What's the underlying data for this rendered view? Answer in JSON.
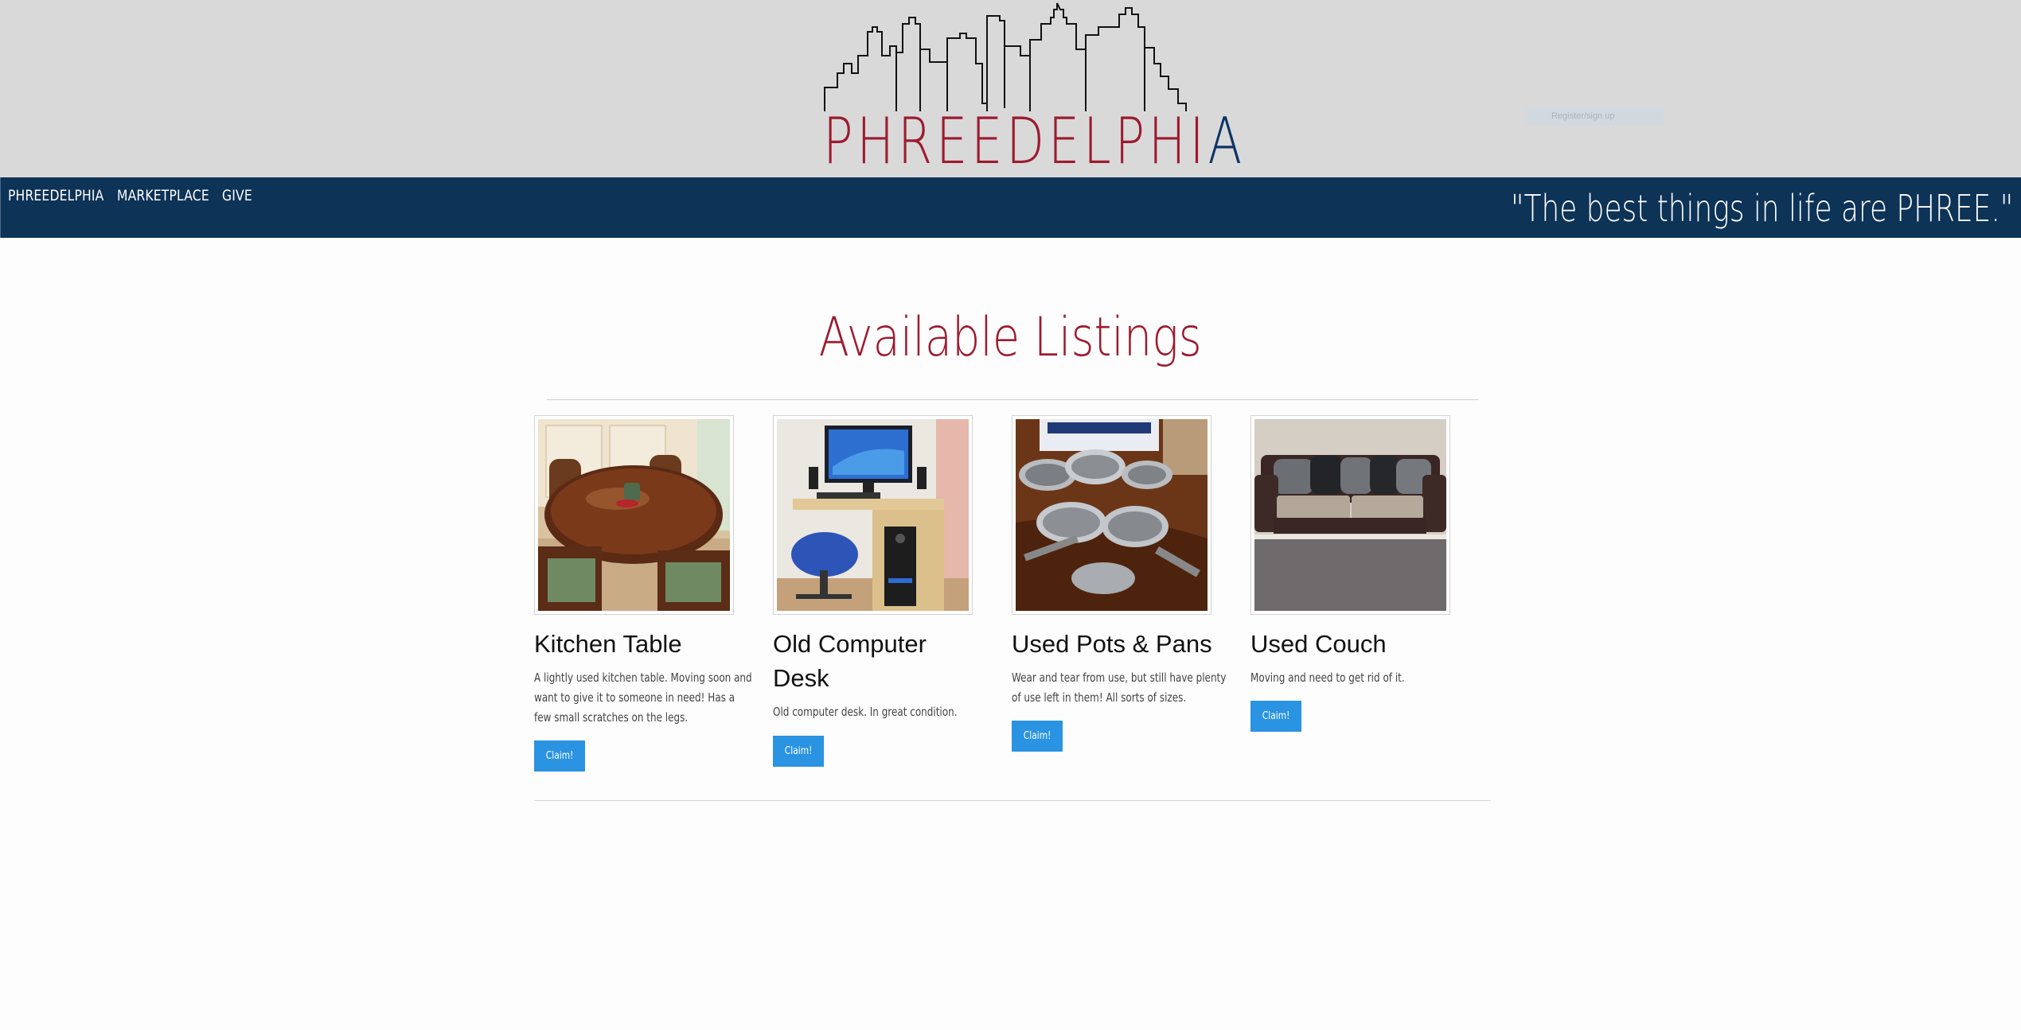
{
  "header": {
    "logo_text_red": "PHREEDELPHI",
    "logo_text_blue": "A",
    "register_placeholder": "Register/sign up"
  },
  "nav": {
    "items": [
      {
        "label": "PHREEDELPHIA"
      },
      {
        "label": "MARKETPLACE"
      },
      {
        "label": "GIVE"
      }
    ],
    "tagline": "\"The best things in life are PHREE.\""
  },
  "main": {
    "title": "Available Listings",
    "listings": [
      {
        "title": "Kitchen Table",
        "description": "A lightly used kitchen table. Moving soon and want to give it to someone in need! Has a few small scratches on the legs.",
        "button": "Claim!",
        "image_icon": "kitchen-table-photo"
      },
      {
        "title": "Old Computer Desk",
        "description": "Old computer desk. In great condition.",
        "button": "Claim!",
        "image_icon": "computer-desk-photo"
      },
      {
        "title": "Used Pots & Pans",
        "description": "Wear and tear from use, but still have plenty of use left in them! All sorts of sizes.",
        "button": "Claim!",
        "image_icon": "pots-pans-photo"
      },
      {
        "title": "Used Couch",
        "description": "Moving and need to get rid of it.",
        "button": "Claim!",
        "image_icon": "couch-photo"
      }
    ]
  },
  "colors": {
    "header_bg": "#d9d9d9",
    "nav_bg": "#0d3357",
    "title_red": "#9c1b2f",
    "button_blue": "#2a93e2"
  }
}
